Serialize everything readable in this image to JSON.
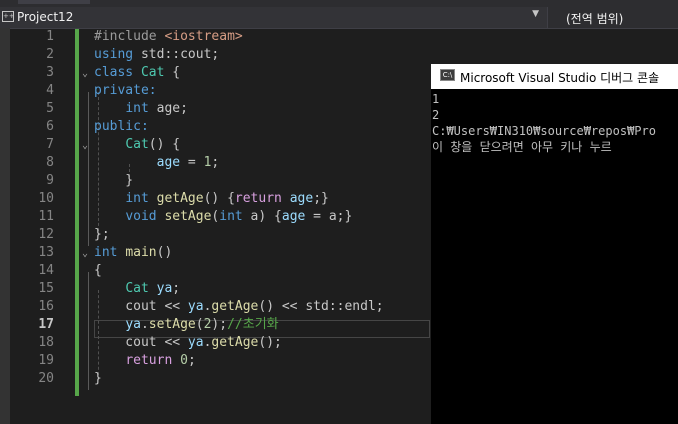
{
  "topbar": {
    "project": "Project12",
    "scope": "(전역 범위)",
    "project_icon": "cpp-project-icon",
    "dropdown_icon": "chevron-down-icon"
  },
  "editor": {
    "active_line": 17,
    "line_numbers": [
      "1",
      "2",
      "3",
      "4",
      "5",
      "6",
      "7",
      "8",
      "9",
      "10",
      "11",
      "12",
      "13",
      "14",
      "15",
      "16",
      "17",
      "18",
      "19",
      "20"
    ],
    "lines": [
      [
        {
          "t": "#include ",
          "c": "pp"
        },
        {
          "t": "<iostream>",
          "c": "inc"
        }
      ],
      [
        {
          "t": "using",
          "c": "kw"
        },
        {
          "t": " std::cout;",
          "c": "ns"
        }
      ],
      [
        {
          "t": "class",
          "c": "kw"
        },
        {
          "t": " ",
          "c": "ns"
        },
        {
          "t": "Cat",
          "c": "cls"
        },
        {
          "t": " {",
          "c": "ns"
        }
      ],
      [
        {
          "t": "private:",
          "c": "kw"
        }
      ],
      [
        {
          "t": "    ",
          "c": "ns"
        },
        {
          "t": "int",
          "c": "kw"
        },
        {
          "t": " age;",
          "c": "ns"
        }
      ],
      [
        {
          "t": "public:",
          "c": "kw"
        }
      ],
      [
        {
          "t": "    ",
          "c": "ns"
        },
        {
          "t": "Cat",
          "c": "cls"
        },
        {
          "t": "() {",
          "c": "ns"
        }
      ],
      [
        {
          "t": "        ",
          "c": "ns"
        },
        {
          "t": "age",
          "c": "var"
        },
        {
          "t": " = ",
          "c": "ns"
        },
        {
          "t": "1",
          "c": "num"
        },
        {
          "t": ";",
          "c": "ns"
        }
      ],
      [
        {
          "t": "    }",
          "c": "ns"
        }
      ],
      [
        {
          "t": "    ",
          "c": "ns"
        },
        {
          "t": "int",
          "c": "kw"
        },
        {
          "t": " ",
          "c": "ns"
        },
        {
          "t": "getAge",
          "c": "fn"
        },
        {
          "t": "() {",
          "c": "ns"
        },
        {
          "t": "return",
          "c": "ret"
        },
        {
          "t": " ",
          "c": "ns"
        },
        {
          "t": "age",
          "c": "var"
        },
        {
          "t": ";}",
          "c": "ns"
        }
      ],
      [
        {
          "t": "    ",
          "c": "ns"
        },
        {
          "t": "void",
          "c": "kw"
        },
        {
          "t": " ",
          "c": "ns"
        },
        {
          "t": "setAge",
          "c": "fn"
        },
        {
          "t": "(",
          "c": "ns"
        },
        {
          "t": "int",
          "c": "kw"
        },
        {
          "t": " a) {",
          "c": "ns"
        },
        {
          "t": "age",
          "c": "var"
        },
        {
          "t": " = a;}",
          "c": "ns"
        }
      ],
      [
        {
          "t": "};",
          "c": "ns"
        }
      ],
      [
        {
          "t": "int",
          "c": "kw"
        },
        {
          "t": " ",
          "c": "ns"
        },
        {
          "t": "main",
          "c": "fn"
        },
        {
          "t": "()",
          "c": "ns"
        }
      ],
      [
        {
          "t": "{",
          "c": "ns"
        }
      ],
      [
        {
          "t": "    ",
          "c": "ns"
        },
        {
          "t": "Cat",
          "c": "cls"
        },
        {
          "t": " ",
          "c": "ns"
        },
        {
          "t": "ya",
          "c": "var"
        },
        {
          "t": ";",
          "c": "ns"
        }
      ],
      [
        {
          "t": "    cout << ",
          "c": "ns"
        },
        {
          "t": "ya",
          "c": "var"
        },
        {
          "t": ".",
          "c": "ns"
        },
        {
          "t": "getAge",
          "c": "fn"
        },
        {
          "t": "() << std::endl;",
          "c": "ns"
        }
      ],
      [
        {
          "t": "    ",
          "c": "ns"
        },
        {
          "t": "ya",
          "c": "var"
        },
        {
          "t": ".",
          "c": "ns"
        },
        {
          "t": "setAge",
          "c": "fn"
        },
        {
          "t": "(",
          "c": "ns"
        },
        {
          "t": "2",
          "c": "num"
        },
        {
          "t": ");",
          "c": "ns"
        },
        {
          "t": "//초기화",
          "c": "cmt"
        }
      ],
      [
        {
          "t": "    cout << ",
          "c": "ns"
        },
        {
          "t": "ya",
          "c": "var"
        },
        {
          "t": ".",
          "c": "ns"
        },
        {
          "t": "getAge",
          "c": "fn"
        },
        {
          "t": "();",
          "c": "ns"
        }
      ],
      [
        {
          "t": "    ",
          "c": "ns"
        },
        {
          "t": "return",
          "c": "ret"
        },
        {
          "t": " ",
          "c": "ns"
        },
        {
          "t": "0",
          "c": "num"
        },
        {
          "t": ";",
          "c": "ns"
        }
      ],
      [
        {
          "t": "}",
          "c": "ns"
        }
      ]
    ],
    "fold_icon": "chevron-down-icon"
  },
  "console": {
    "title": "Microsoft Visual Studio 디버그 콘솔",
    "icon": "console-app-icon",
    "lines": [
      "1",
      "2",
      "C:₩Users₩IN310₩source₩repos₩Pro",
      "이 창을 닫으려면 아무 키나 누르"
    ]
  },
  "colors": {
    "editor_bg": "#1e1e1e",
    "keyword": "#569cd6",
    "type": "#4ec9b0",
    "function": "#dcdcaa",
    "variable": "#9cdcfe",
    "number": "#b5cea8",
    "comment": "#57a64a",
    "change_bar": "#57a64a",
    "console_bg": "#000000"
  }
}
